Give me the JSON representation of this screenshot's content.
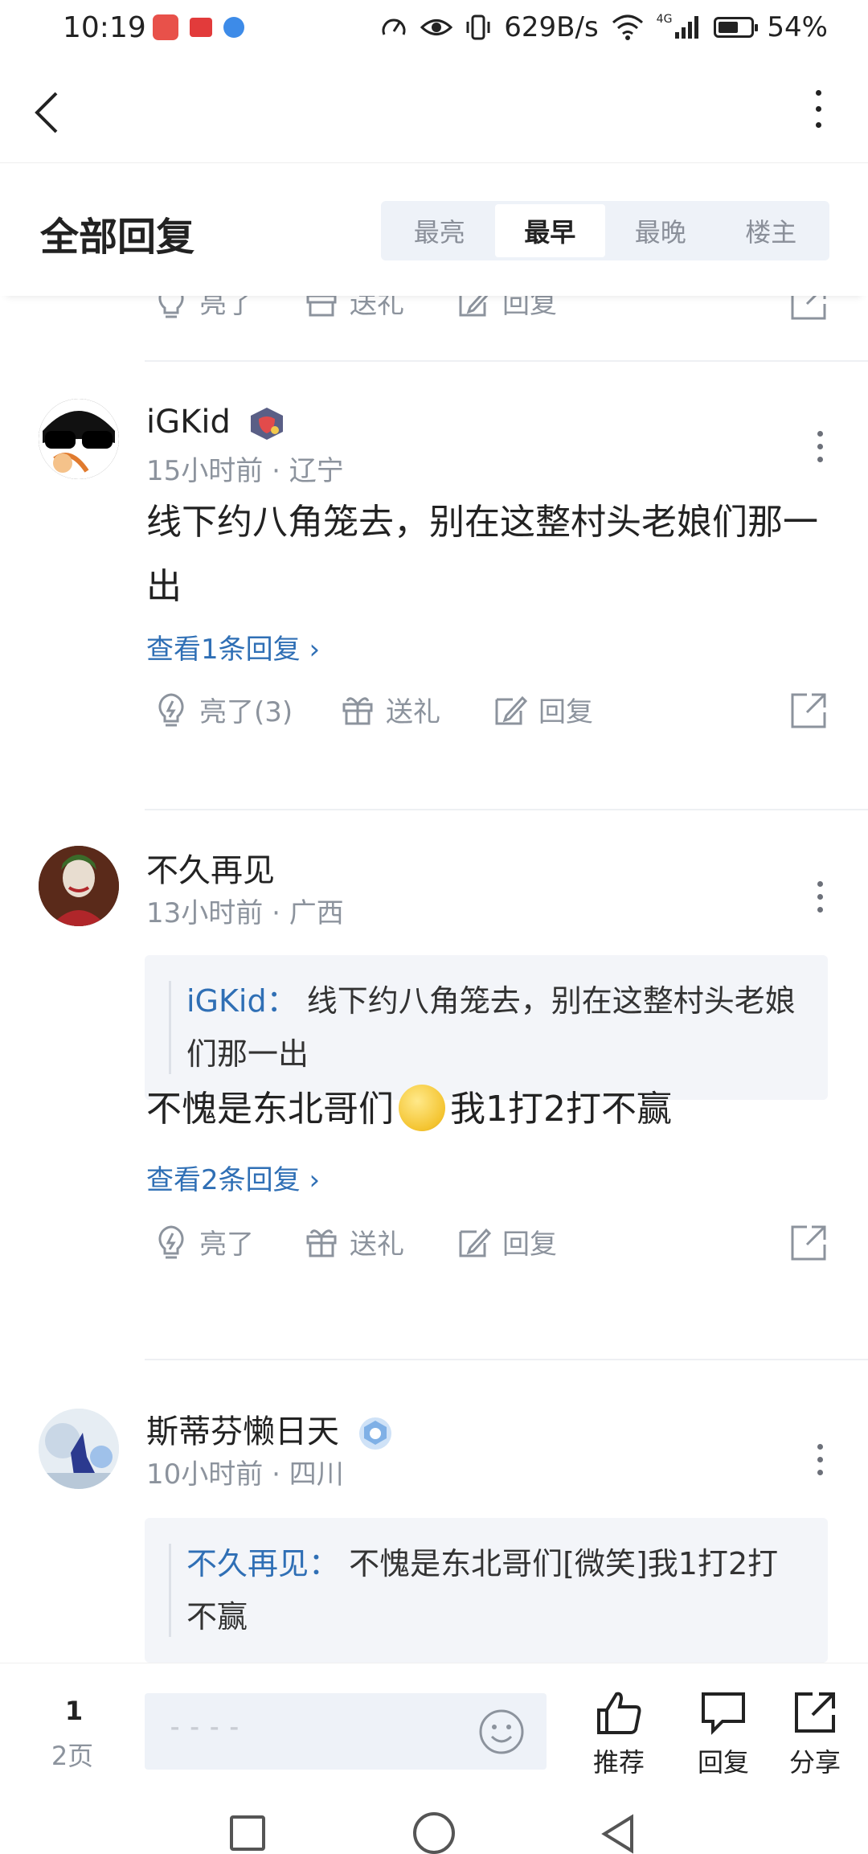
{
  "status_bar": {
    "time": "10:19",
    "speed": "629B/s",
    "network": "4G",
    "battery": "54%"
  },
  "header": {
    "title": "全部回复",
    "sort_tabs": [
      "最亮",
      "最早",
      "最晚",
      "楼主"
    ],
    "active_tab": "最早"
  },
  "partial_actions": [
    "亮了",
    "送礼",
    "回复"
  ],
  "comments": [
    {
      "username": "iGKid",
      "time": "15小时前",
      "region": "辽宁",
      "content": "线下约八角笼去，别在这整村头老娘们那一出",
      "replies_link": "查看1条回复",
      "like_label": "亮了(3)",
      "gift_label": "送礼",
      "reply_label": "回复"
    },
    {
      "username": "不久再见",
      "time": "13小时前",
      "region": "广西",
      "quote_user": "iGKid：",
      "quote_text": "线下约八角笼去，别在这整村头老娘们那一出",
      "content_before": "不愧是东北哥们",
      "content_after": "我1打2打不赢",
      "replies_link": "查看2条回复",
      "like_label": "亮了",
      "gift_label": "送礼",
      "reply_label": "回复"
    },
    {
      "username": "斯蒂芬懒日天",
      "time": "10小时前",
      "region": "四川",
      "quote_user": "不久再见：",
      "quote_text": "不愧是东北哥们[微笑]我1打2打不赢"
    }
  ],
  "bottom_bar": {
    "page_current": "1",
    "page_total": "2页",
    "recommend_label": "推荐",
    "reply_label": "回复",
    "share_label": "分享"
  },
  "colors": {
    "link": "#2f6fb5",
    "meta": "#8c939d",
    "tabs_bg": "#eef2f8"
  }
}
